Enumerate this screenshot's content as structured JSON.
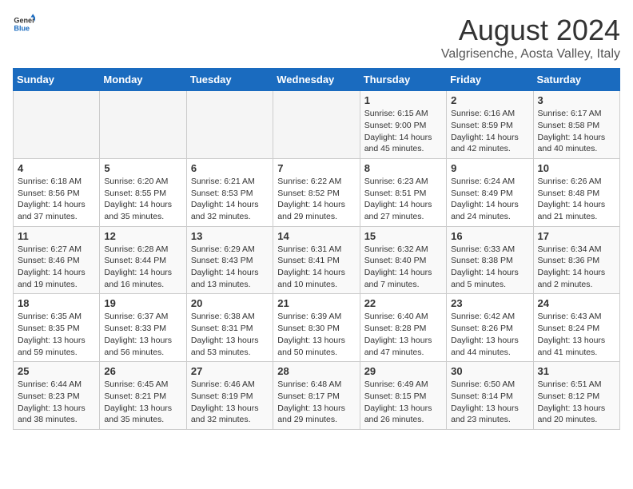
{
  "header": {
    "logo_general": "General",
    "logo_blue": "Blue",
    "title": "August 2024",
    "subtitle": "Valgrisenche, Aosta Valley, Italy"
  },
  "weekdays": [
    "Sunday",
    "Monday",
    "Tuesday",
    "Wednesday",
    "Thursday",
    "Friday",
    "Saturday"
  ],
  "weeks": [
    [
      {
        "day": "",
        "detail": ""
      },
      {
        "day": "",
        "detail": ""
      },
      {
        "day": "",
        "detail": ""
      },
      {
        "day": "",
        "detail": ""
      },
      {
        "day": "1",
        "detail": "Sunrise: 6:15 AM\nSunset: 9:00 PM\nDaylight: 14 hours and 45 minutes."
      },
      {
        "day": "2",
        "detail": "Sunrise: 6:16 AM\nSunset: 8:59 PM\nDaylight: 14 hours and 42 minutes."
      },
      {
        "day": "3",
        "detail": "Sunrise: 6:17 AM\nSunset: 8:58 PM\nDaylight: 14 hours and 40 minutes."
      }
    ],
    [
      {
        "day": "4",
        "detail": "Sunrise: 6:18 AM\nSunset: 8:56 PM\nDaylight: 14 hours and 37 minutes."
      },
      {
        "day": "5",
        "detail": "Sunrise: 6:20 AM\nSunset: 8:55 PM\nDaylight: 14 hours and 35 minutes."
      },
      {
        "day": "6",
        "detail": "Sunrise: 6:21 AM\nSunset: 8:53 PM\nDaylight: 14 hours and 32 minutes."
      },
      {
        "day": "7",
        "detail": "Sunrise: 6:22 AM\nSunset: 8:52 PM\nDaylight: 14 hours and 29 minutes."
      },
      {
        "day": "8",
        "detail": "Sunrise: 6:23 AM\nSunset: 8:51 PM\nDaylight: 14 hours and 27 minutes."
      },
      {
        "day": "9",
        "detail": "Sunrise: 6:24 AM\nSunset: 8:49 PM\nDaylight: 14 hours and 24 minutes."
      },
      {
        "day": "10",
        "detail": "Sunrise: 6:26 AM\nSunset: 8:48 PM\nDaylight: 14 hours and 21 minutes."
      }
    ],
    [
      {
        "day": "11",
        "detail": "Sunrise: 6:27 AM\nSunset: 8:46 PM\nDaylight: 14 hours and 19 minutes."
      },
      {
        "day": "12",
        "detail": "Sunrise: 6:28 AM\nSunset: 8:44 PM\nDaylight: 14 hours and 16 minutes."
      },
      {
        "day": "13",
        "detail": "Sunrise: 6:29 AM\nSunset: 8:43 PM\nDaylight: 14 hours and 13 minutes."
      },
      {
        "day": "14",
        "detail": "Sunrise: 6:31 AM\nSunset: 8:41 PM\nDaylight: 14 hours and 10 minutes."
      },
      {
        "day": "15",
        "detail": "Sunrise: 6:32 AM\nSunset: 8:40 PM\nDaylight: 14 hours and 7 minutes."
      },
      {
        "day": "16",
        "detail": "Sunrise: 6:33 AM\nSunset: 8:38 PM\nDaylight: 14 hours and 5 minutes."
      },
      {
        "day": "17",
        "detail": "Sunrise: 6:34 AM\nSunset: 8:36 PM\nDaylight: 14 hours and 2 minutes."
      }
    ],
    [
      {
        "day": "18",
        "detail": "Sunrise: 6:35 AM\nSunset: 8:35 PM\nDaylight: 13 hours and 59 minutes."
      },
      {
        "day": "19",
        "detail": "Sunrise: 6:37 AM\nSunset: 8:33 PM\nDaylight: 13 hours and 56 minutes."
      },
      {
        "day": "20",
        "detail": "Sunrise: 6:38 AM\nSunset: 8:31 PM\nDaylight: 13 hours and 53 minutes."
      },
      {
        "day": "21",
        "detail": "Sunrise: 6:39 AM\nSunset: 8:30 PM\nDaylight: 13 hours and 50 minutes."
      },
      {
        "day": "22",
        "detail": "Sunrise: 6:40 AM\nSunset: 8:28 PM\nDaylight: 13 hours and 47 minutes."
      },
      {
        "day": "23",
        "detail": "Sunrise: 6:42 AM\nSunset: 8:26 PM\nDaylight: 13 hours and 44 minutes."
      },
      {
        "day": "24",
        "detail": "Sunrise: 6:43 AM\nSunset: 8:24 PM\nDaylight: 13 hours and 41 minutes."
      }
    ],
    [
      {
        "day": "25",
        "detail": "Sunrise: 6:44 AM\nSunset: 8:23 PM\nDaylight: 13 hours and 38 minutes."
      },
      {
        "day": "26",
        "detail": "Sunrise: 6:45 AM\nSunset: 8:21 PM\nDaylight: 13 hours and 35 minutes."
      },
      {
        "day": "27",
        "detail": "Sunrise: 6:46 AM\nSunset: 8:19 PM\nDaylight: 13 hours and 32 minutes."
      },
      {
        "day": "28",
        "detail": "Sunrise: 6:48 AM\nSunset: 8:17 PM\nDaylight: 13 hours and 29 minutes."
      },
      {
        "day": "29",
        "detail": "Sunrise: 6:49 AM\nSunset: 8:15 PM\nDaylight: 13 hours and 26 minutes."
      },
      {
        "day": "30",
        "detail": "Sunrise: 6:50 AM\nSunset: 8:14 PM\nDaylight: 13 hours and 23 minutes."
      },
      {
        "day": "31",
        "detail": "Sunrise: 6:51 AM\nSunset: 8:12 PM\nDaylight: 13 hours and 20 minutes."
      }
    ]
  ]
}
